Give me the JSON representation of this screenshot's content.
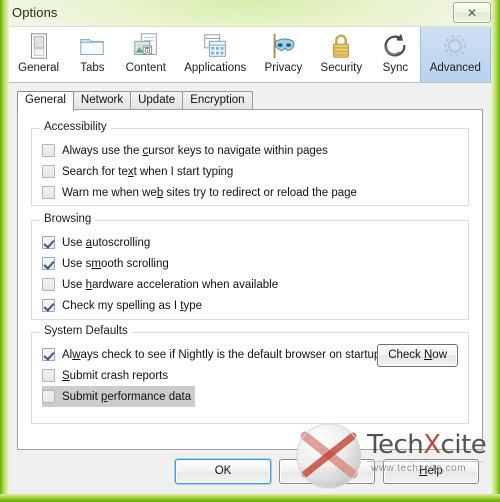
{
  "window": {
    "title": "Options",
    "close_label": "✕",
    "close_icon": "close-icon"
  },
  "toolbar": {
    "categories": [
      {
        "label": "General",
        "icon": "general-window-icon",
        "selected": false
      },
      {
        "label": "Tabs",
        "icon": "tabs-folder-icon",
        "selected": false
      },
      {
        "label": "Content",
        "icon": "content-page-icon",
        "selected": false
      },
      {
        "label": "Applications",
        "icon": "applications-icon",
        "selected": false
      },
      {
        "label": "Privacy",
        "icon": "privacy-mask-icon",
        "selected": false
      },
      {
        "label": "Security",
        "icon": "security-lock-icon",
        "selected": false
      },
      {
        "label": "Sync",
        "icon": "sync-arrows-icon",
        "selected": false
      },
      {
        "label": "Advanced",
        "icon": "advanced-gear-icon",
        "selected": true
      }
    ]
  },
  "tabs": [
    {
      "label": "General",
      "active": true
    },
    {
      "label": "Network",
      "active": false
    },
    {
      "label": "Update",
      "active": false
    },
    {
      "label": "Encryption",
      "active": false
    }
  ],
  "groups": [
    {
      "title": "Accessibility",
      "rows": [
        {
          "label_pre": "Always use the ",
          "accel": "c",
          "label_post": "ursor keys to navigate within pages",
          "checked": false,
          "highlight": false
        },
        {
          "label_pre": "Search for te",
          "accel": "x",
          "label_post": "t when I start typing",
          "checked": false,
          "highlight": false
        },
        {
          "label_pre": "Warn me when we",
          "accel": "b",
          "label_post": " sites try to redirect or reload the page",
          "checked": false,
          "highlight": false
        }
      ]
    },
    {
      "title": "Browsing",
      "rows": [
        {
          "label_pre": "Use ",
          "accel": "a",
          "label_post": "utoscrolling",
          "checked": true,
          "highlight": false
        },
        {
          "label_pre": "Use s",
          "accel": "m",
          "label_post": "ooth scrolling",
          "checked": true,
          "highlight": false
        },
        {
          "label_pre": "Use ",
          "accel": "h",
          "label_post": "ardware acceleration when available",
          "checked": false,
          "highlight": false
        },
        {
          "label_pre": "Check my spelling as I ",
          "accel": "t",
          "label_post": "ype",
          "checked": true,
          "highlight": false
        }
      ]
    },
    {
      "title": "System Defaults",
      "rows": [
        {
          "label_pre": "Al",
          "accel": "w",
          "label_post": "ays check to see if Nightly is the default browser on startup",
          "checked": true,
          "highlight": false
        },
        {
          "label_pre": "",
          "accel": "S",
          "label_post": "ubmit crash reports",
          "checked": false,
          "highlight": false
        },
        {
          "label_pre": "Submit ",
          "accel": "p",
          "label_post": "erformance data",
          "checked": false,
          "highlight": true
        }
      ],
      "button": {
        "label_pre": "Check ",
        "accel": "N",
        "label_post": "ow"
      }
    }
  ],
  "footer": {
    "buttons": [
      {
        "label_pre": "OK",
        "accel": "",
        "label_post": "",
        "default": true
      },
      {
        "label_pre": "Cancel",
        "accel": "",
        "label_post": "",
        "default": false
      },
      {
        "label_pre": "",
        "accel": "H",
        "label_post": "elp",
        "default": false
      }
    ]
  },
  "watermark": {
    "brand_a": "Tech",
    "brand_x": "X",
    "brand_b": "cite",
    "url": "www.techxcite.com"
  },
  "colors": {
    "frame_green": "#7cc000",
    "selected_tab_blue": "#b9d2ef",
    "highlight_gray": "#cccccc",
    "default_button_focus": "#3c9ad6"
  }
}
